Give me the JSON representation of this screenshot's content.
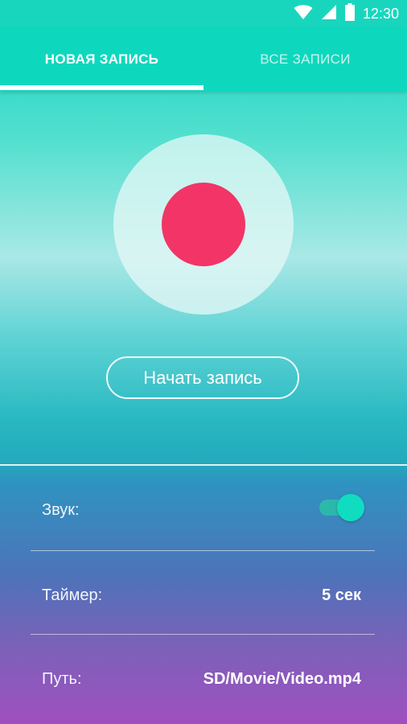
{
  "status_bar": {
    "time": "12:30",
    "icons": [
      "wifi-icon",
      "signal-icon",
      "battery-icon"
    ]
  },
  "tabs": [
    {
      "label": "НОВАЯ ЗАПИСЬ",
      "selected": true
    },
    {
      "label": "ВСЕ ЗАПИСИ",
      "selected": false
    }
  ],
  "record": {
    "icon": "record-icon",
    "start_label": "Начать запись"
  },
  "settings": {
    "sound": {
      "label": "Звук:",
      "enabled": true
    },
    "timer": {
      "label": "Таймер:",
      "value": "5 сек"
    },
    "path": {
      "label": "Путь:",
      "value": "SD/Movie/Video.mp4"
    }
  },
  "colors": {
    "accent": "#0dd8be",
    "record": "#f23566",
    "bottom_gradient_start": "#2f93c1",
    "bottom_gradient_end": "#a04fbf"
  }
}
